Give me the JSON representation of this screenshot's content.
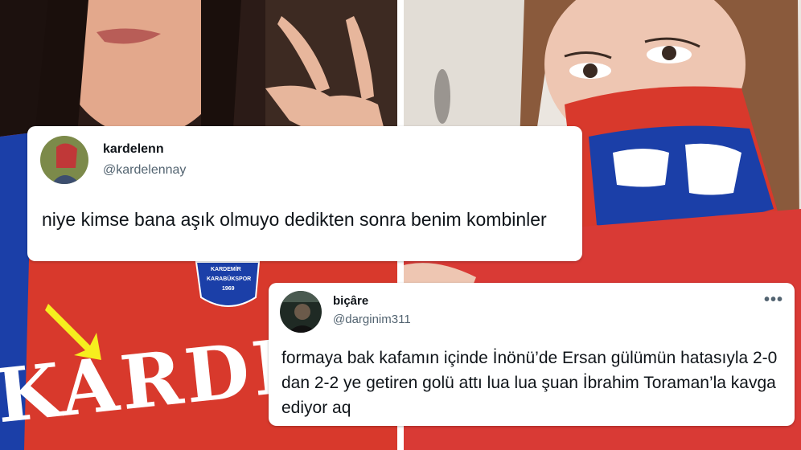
{
  "tweets": [
    {
      "display_name": "kardelenn",
      "handle": "@kardelennay",
      "text": "niye kimse bana aşık olmuyo dedikten sonra benim kombinler"
    },
    {
      "display_name": "biçâre",
      "handle": "@darginim311",
      "text": "formaya bak kafamın içinde İnönü’de Ersan gülümün hatasıyla 2-0 dan 2-2 ye getiren golü attı lua lua şuan İbrahim Toraman’la kavga ediyor aq",
      "more_icon": "•••"
    }
  ],
  "photo_left": {
    "jersey_text": "KARDEMİR",
    "badge_line1": "KARDEMİR",
    "badge_line2": "KARABÜKSPOR",
    "badge_line3": "1969"
  },
  "colors": {
    "jersey_red": "#d8392c",
    "scarf_blue": "#1b3fa8",
    "arrow_yellow": "#f6ee1e"
  }
}
